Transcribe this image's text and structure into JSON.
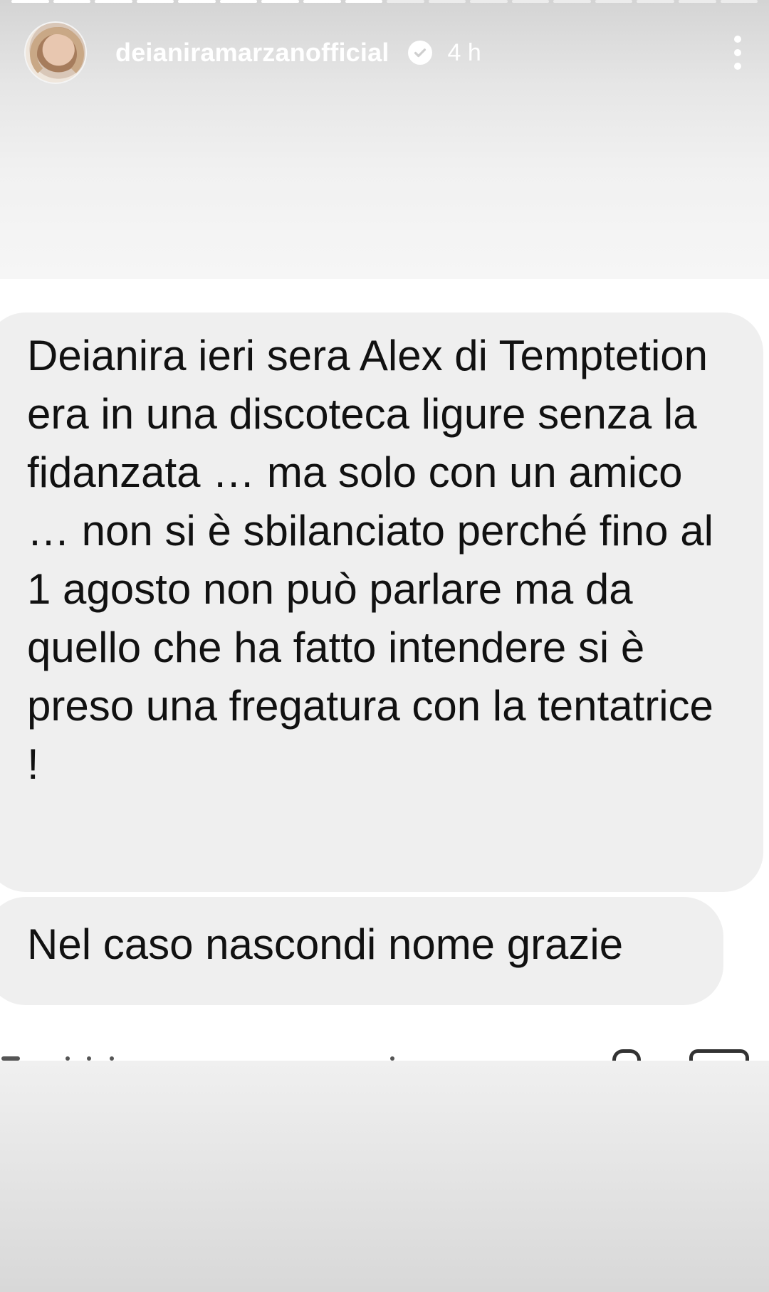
{
  "story": {
    "progress": {
      "total": 18,
      "current": 9
    },
    "header": {
      "username": "deianiramarzanofficial",
      "time": "4 h",
      "verified_icon": "verified-badge-icon",
      "more_icon": "more-vertical-icon"
    }
  },
  "messages": [
    {
      "text": "Deianira ieri sera Alex di Temptetion era in una discoteca ligure senza la fidanzata … ma solo con un amico … non si è sbilanciato perché fino al 1 agosto non può parlare ma da quello che ha fatto intendere si è preso una fregatura con la tentatrice !"
    },
    {
      "text": "Nel caso nascondi nome grazie"
    }
  ],
  "colors": {
    "bubble": "#efefef",
    "text": "#111111",
    "header_text": "#ffffff"
  }
}
